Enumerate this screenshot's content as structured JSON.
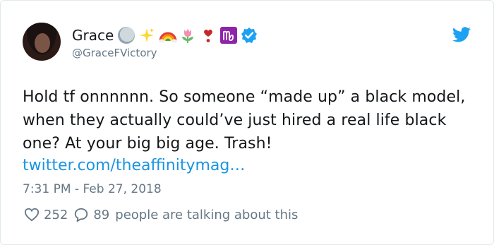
{
  "user": {
    "display_name": "Grace",
    "handle": "@GraceFVictory",
    "name_emojis": [
      "moon-icon",
      "sparkles-icon",
      "rainbow-icon",
      "tulip-icon",
      "heart-exclamation-icon",
      "virgo-icon",
      "verified-badge-icon"
    ]
  },
  "tweet": {
    "text": "Hold tf onnnnnn. So someone “made up” a black model, when they actually could’ve just hired a real life black one? At your big big age. Trash!",
    "link": "twitter.com/theaffinitymag…",
    "timestamp": "7:31 PM - Feb 27, 2018"
  },
  "actions": {
    "likes": "252",
    "comments": "89",
    "talking": "people are talking about this"
  },
  "colors": {
    "link": "#1b95e0",
    "secondary_text": "#657786",
    "twitter_blue": "#1da1f2",
    "border": "#e1e8ed"
  }
}
